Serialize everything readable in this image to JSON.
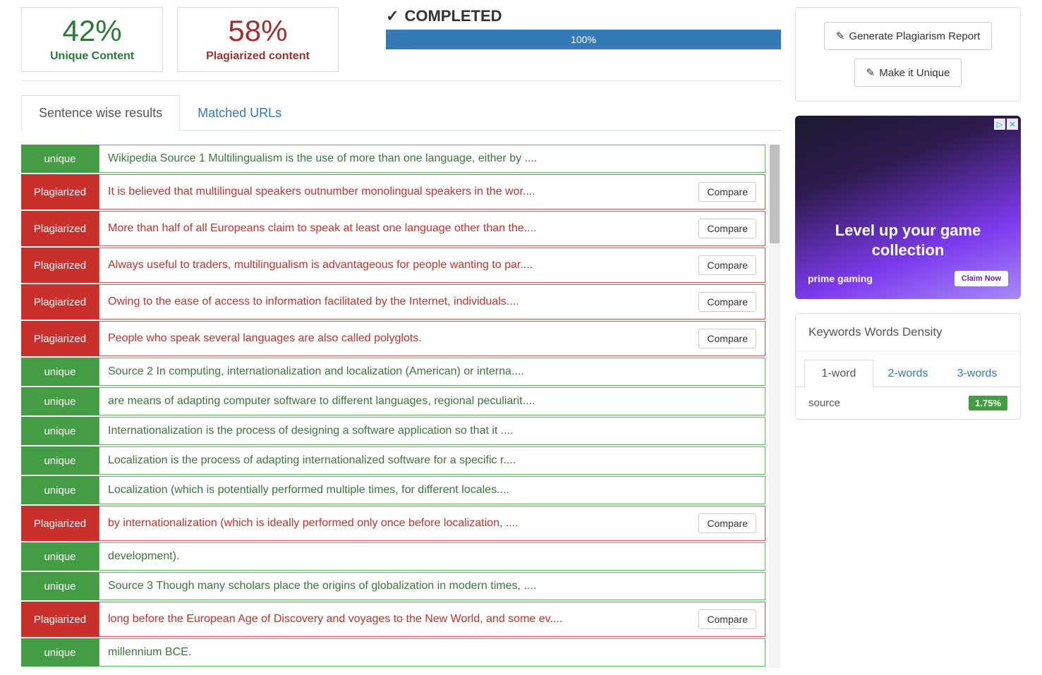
{
  "stats": {
    "unique_percent": "42%",
    "unique_label": "Unique Content",
    "plag_percent": "58%",
    "plag_label": "Plagiarized content",
    "completed_label": "COMPLETED",
    "progress_text": "100%"
  },
  "tabs": {
    "sentence": "Sentence wise results",
    "matched": "Matched URLs"
  },
  "compare_label": "Compare",
  "status_labels": {
    "unique": "unique",
    "plagiarized": "Plagiarized"
  },
  "results": [
    {
      "status": "unique",
      "text": "Wikipedia Source 1 Multilingualism is the use of more than one language, either by ...."
    },
    {
      "status": "plagiarized",
      "text": "It is believed that multilingual speakers outnumber monolingual speakers in the wor...."
    },
    {
      "status": "plagiarized",
      "text": "More than half of all Europeans claim to speak at least one language other than the...."
    },
    {
      "status": "plagiarized",
      "text": "Always useful to traders, multilingualism is advantageous for people wanting to par...."
    },
    {
      "status": "plagiarized",
      "text": "Owing to the ease of access to information facilitated by the Internet, individuals...."
    },
    {
      "status": "plagiarized",
      "text": "People who speak several languages are also called polyglots."
    },
    {
      "status": "unique",
      "text": "Source 2 In computing, internationalization and localization (American) or interna...."
    },
    {
      "status": "unique",
      "text": "are means of adapting computer software to different languages, regional peculiarit...."
    },
    {
      "status": "unique",
      "text": "Internationalization is the process of designing a software application so that it ...."
    },
    {
      "status": "unique",
      "text": "Localization is the process of adapting internationalized software for a specific r...."
    },
    {
      "status": "unique",
      "text": "Localization (which is potentially performed multiple times, for different locales...."
    },
    {
      "status": "plagiarized",
      "text": "by internationalization (which is ideally performed only once before localization, ...."
    },
    {
      "status": "unique",
      "text": "development)."
    },
    {
      "status": "unique",
      "text": "Source 3 Though many scholars place the origins of globalization in modern times, ...."
    },
    {
      "status": "plagiarized",
      "text": "long before the European Age of Discovery and voyages to the New World, and some ev...."
    },
    {
      "status": "unique",
      "text": "millennium BCE."
    }
  ],
  "actions": {
    "generate": "Generate Plagiarism Report",
    "make_unique": "Make it Unique"
  },
  "ad": {
    "headline": "Level up your game collection",
    "brand": "prime gaming",
    "claim": "Claim Now"
  },
  "keywords": {
    "title": "Keywords Words Density",
    "tabs": {
      "one": "1-word",
      "two": "2-words",
      "three": "3-words"
    },
    "rows": [
      {
        "word": "source",
        "pct": "1.75%"
      }
    ]
  }
}
